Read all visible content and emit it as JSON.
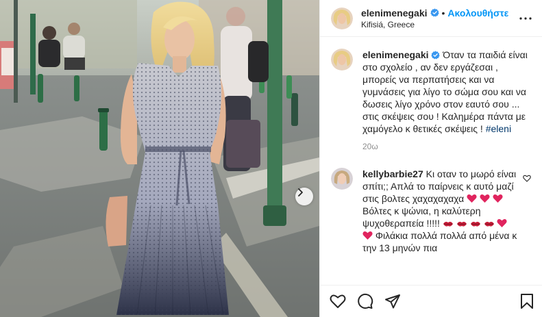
{
  "post": {
    "username": "elenimenegaki",
    "follow_label": "Ακολουθήστε",
    "separator": "•",
    "location": "Kifisiá, Greece",
    "caption": "Όταν τα παιδιά είναι στο σχολείο , αν δεν εργάζεσαι , μπορείς να περπατήσεις και να γυμνάσεις για λίγο το σώμα σου και να δωσεις λίγο χρόνο στον εαυτό σου ... στις σκέψεις σου ! Καλημέρα πάντα με χαμόγελο κ θετικές σκέψεις !",
    "hashtag": "#eleni",
    "age": "20ω"
  },
  "comment": {
    "username": "kellybarbie27",
    "text_1": "Κι οταν το μωρό είναι σπίτι;; Απλά το παίρνεις κ αυτό μαζί στις βολτες χαχαχαχαχα",
    "text_2": "Βόλτες κ ψώνια, η καλύτερη ψυχοθεραπεία !!!!!",
    "text_3": "Φιλάκια πολλά πολλά από μένα κ την 13 μηνών πια"
  },
  "icons": {
    "verified": "verified-badge-icon",
    "more": "more-options-icon",
    "next": "chevron-right-icon",
    "like": "heart-icon",
    "comment": "comment-icon",
    "share": "paper-plane-icon",
    "save": "bookmark-icon",
    "comment_like": "heart-outline-icon",
    "emoji_heart": "red-heart-emoji",
    "emoji_lips": "kiss-mark-emoji"
  },
  "colors": {
    "accent": "#0095f6",
    "hashtag": "#00376b",
    "muted": "#8e8e8e",
    "emoji_red": "#e0245e"
  }
}
